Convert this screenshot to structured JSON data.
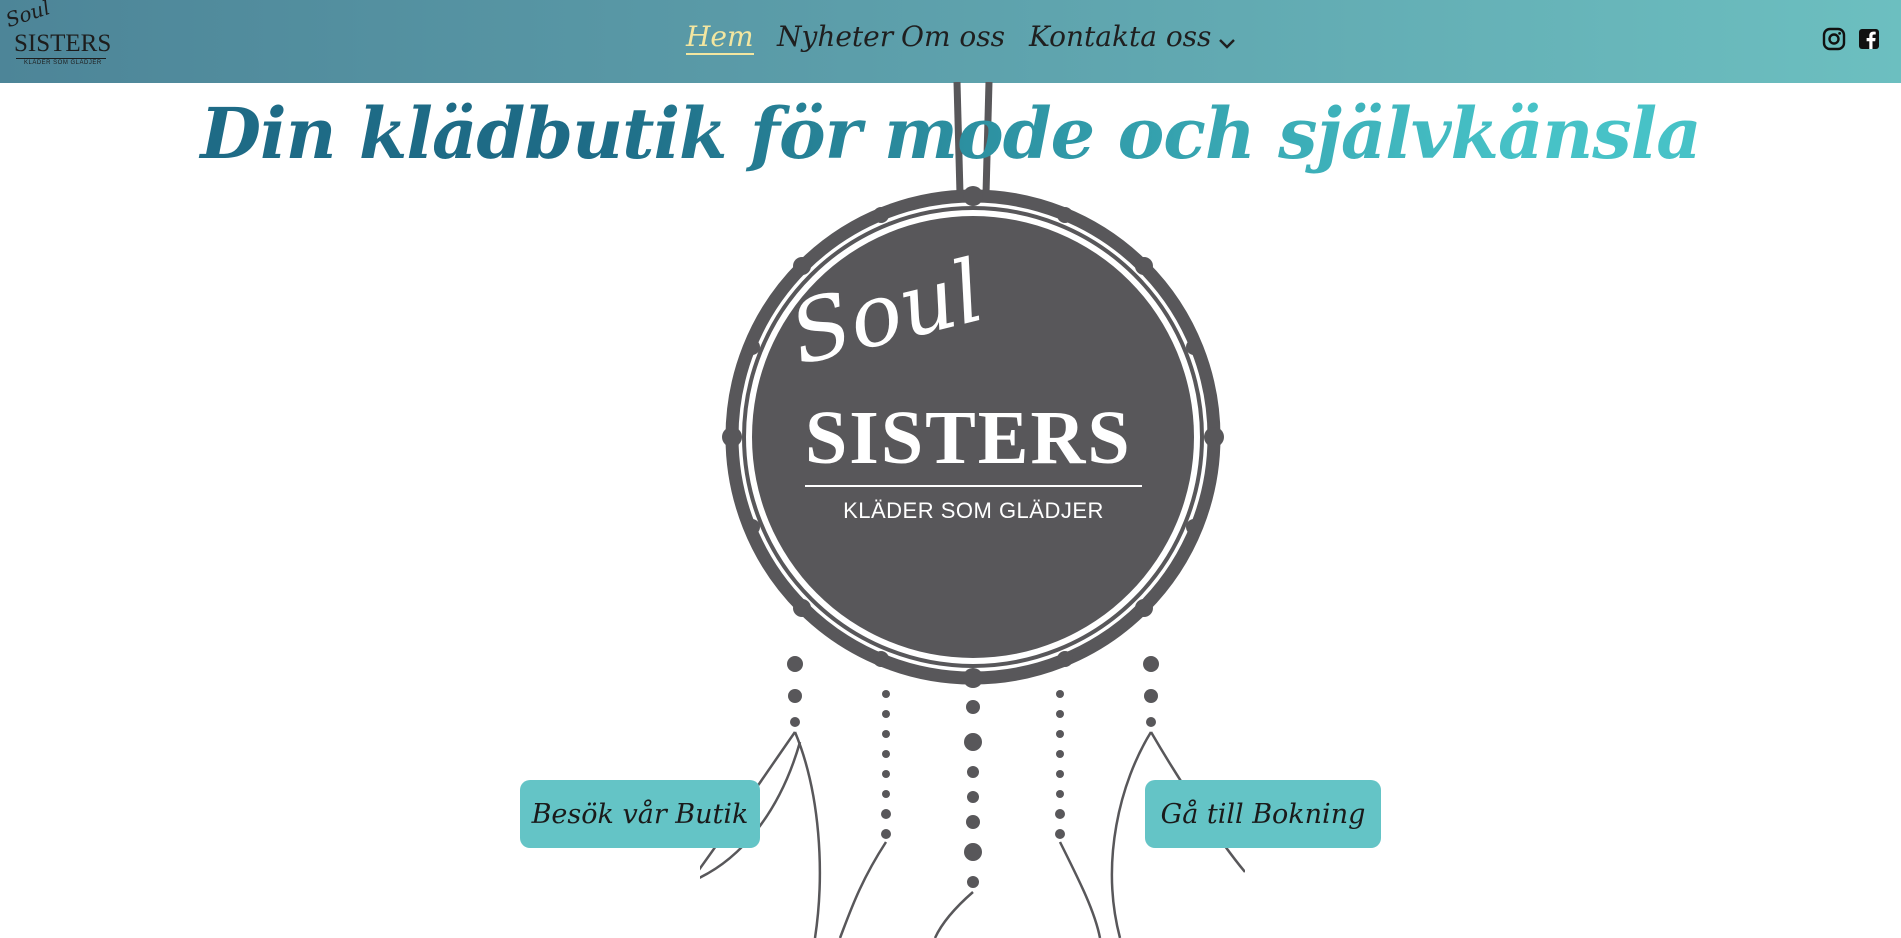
{
  "brand": {
    "logo_small": {
      "soul": "Soul",
      "sisters": "SISTERS",
      "tagline": "KLÄDER SOM GLÄDJER"
    }
  },
  "nav": {
    "items": [
      {
        "label": "Hem",
        "active": true
      },
      {
        "label": "Nyheter",
        "active": false
      },
      {
        "label": "Om oss",
        "active": false
      },
      {
        "label": "Kontakta oss",
        "active": false
      }
    ],
    "more_icon": "chevron-down-icon",
    "social": [
      "instagram-icon",
      "facebook-icon"
    ]
  },
  "hero": {
    "headline": "Din klädbutik för mode och självkänsla",
    "logo": {
      "soul": "Soul",
      "sisters": "SISTERS",
      "tagline": "KLÄDER SOM GLÄDJER"
    },
    "buttons": {
      "shop": "Besök vår Butik",
      "booking": "Gå till Bokning"
    }
  },
  "colors": {
    "nav_gradient": [
      "#4d8598",
      "#6cbfc0"
    ],
    "active_nav": "#f3e6a0",
    "button_bg": "#64c4c6",
    "dreamcatcher": "#58575a",
    "headline_gradient": [
      "#1e6b86",
      "#47c2c7"
    ]
  }
}
